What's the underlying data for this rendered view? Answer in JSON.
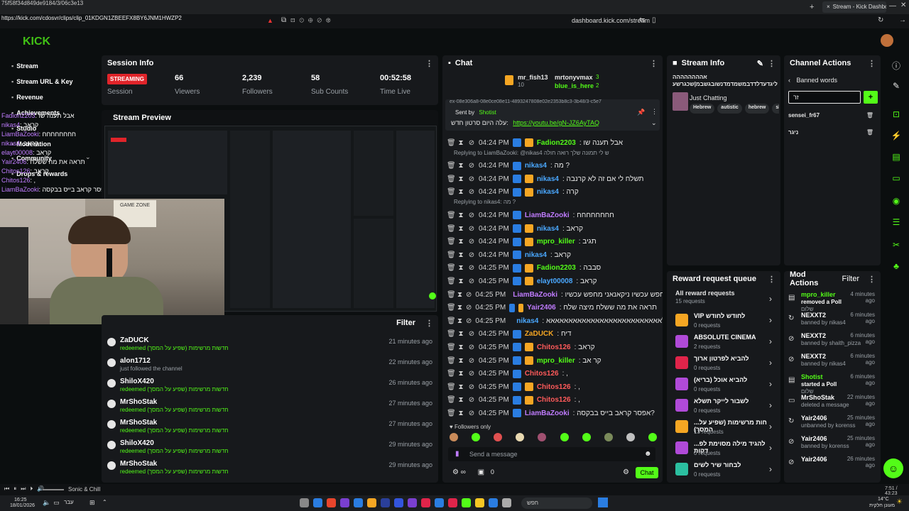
{
  "browser": {
    "tab_label": "Stream - Kick Dashboard",
    "top_left_id": "75f58f34d849de9184/3/06c3e13",
    "url_overlay": "https://kick.com/cdosvr/clips/clip_01KDGN1ZBEEFX8BY6JNM1HWZP2",
    "address": "dashboard.kick.com/stream"
  },
  "left_nav": {
    "items": [
      "Stream",
      "Stream URL & Key",
      "Revenue",
      "Achievements",
      "Studio",
      "Moderation",
      "Community",
      "Drops & rewards"
    ]
  },
  "overlay_chat": [
    {
      "user": "Fadion2203",
      "msg": ": אבל תענה שו"
    },
    {
      "user": "nikas4",
      "msg": ": קראב"
    },
    {
      "user": "LiamBaZooki",
      "msg": ": חחחחחחחח"
    },
    {
      "user": "nikas4",
      "msg": ": קראב"
    },
    {
      "user": "elayt00008",
      "msg": ": קראב"
    },
    {
      "user": "Yair2406",
      "msg": ": תראה את מה ששלח"
    },
    {
      "user": "Chitos126",
      "msg": ": קראב"
    },
    {
      "user": "Chitos126",
      "msg": ": ,"
    },
    {
      "user": "LiamBaZooki",
      "msg": ": אפסר קראב בייס בבקסה?"
    }
  ],
  "session": {
    "title": "Session Info",
    "status": "STREAMING",
    "status_label": "Session",
    "viewers": "66",
    "viewers_label": "Viewers",
    "followers": "2,239",
    "followers_label": "Followers",
    "subs": "58",
    "subs_label": "Sub Counts",
    "time": "00:52:58",
    "time_label": "Time Live"
  },
  "preview": {
    "title": "Stream Preview",
    "webcam_poster": "GAME ZONE"
  },
  "activity": {
    "filter_label": "Filter",
    "items": [
      {
        "name": "ZaDUCK",
        "desc": "redeemed חדשות מרשימות (שפיע על המסך)",
        "time": "21 minutes ago"
      },
      {
        "name": "alon1712",
        "desc": "just followed the channel",
        "time": "22 minutes ago"
      },
      {
        "name": "ShiloX420",
        "desc": "redeemed חדשות מרשימות (שפיע על המסך)",
        "time": "26 minutes ago"
      },
      {
        "name": "MrShoStak",
        "desc": "redeemed חדשות מרשימות (שפיע על המסך)",
        "time": "27 minutes ago"
      },
      {
        "name": "MrShoStak",
        "desc": "redeemed חדשות מרשימות (שפיע על המסך)",
        "time": "27 minutes ago"
      },
      {
        "name": "ShiloX420",
        "desc": "redeemed חדשות מרשימות (שפיע על המסך)",
        "time": "29 minutes ago"
      },
      {
        "name": "MrShoStak",
        "desc": "redeemed חדשות מרשימות (שפיע על המסך)",
        "time": "29 minutes ago"
      }
    ]
  },
  "chat": {
    "title": "Chat",
    "top_gifters": [
      {
        "name": "mr_fish13",
        "count": "10"
      },
      {
        "name": "mrtonyvmax",
        "count": "3"
      },
      {
        "name": "blue_is_here",
        "count": "2"
      }
    ],
    "pinned": {
      "garbled": "ex-08e306a8-08e0ce08e11-4893247808e02e2353b8c3-3b48/3-c5e7",
      "sent_by": "Sent by",
      "sender": "Shotist",
      "text": "עלה היום סרטון חדש:",
      "link": "https://youtu.be/gN-JZ6AyTAQ"
    },
    "messages": [
      {
        "time": "04:24 PM",
        "user": "Fadion2203",
        "msg": ": אבל תענה שו",
        "color": "#53fc18",
        "reply": ""
      },
      {
        "time": "04:24 PM",
        "user": "nikas4",
        "msg": ": מה ?",
        "color": "#4aa8ff",
        "reply": "Replying to LiamBaZooki: @nikas4 ש לי תמונה שלך רואה חולה"
      },
      {
        "time": "04:24 PM",
        "user": "nikas4",
        "msg": ": תשלח לי אם זה לא קרנבה",
        "color": "#4aa8ff",
        "reply": ""
      },
      {
        "time": "04:24 PM",
        "user": "nikas4",
        "msg": ": קרה",
        "color": "#4aa8ff",
        "reply": ""
      },
      {
        "time": "04:24 PM",
        "user": "LiamBaZooki",
        "msg": ": חחחחחחחח",
        "color": "#c07cff",
        "reply": "Replying to nikas4: מה ?"
      },
      {
        "time": "04:24 PM",
        "user": "nikas4",
        "msg": ": קראב",
        "color": "#4aa8ff",
        "reply": ""
      },
      {
        "time": "04:24 PM",
        "user": "mpro_killer",
        "msg": ": תגיב",
        "color": "#53fc18",
        "reply": ""
      },
      {
        "time": "04:24 PM",
        "user": "nikas4",
        "msg": ": קראב",
        "color": "#4aa8ff",
        "reply": ""
      },
      {
        "time": "04:25 PM",
        "user": "Fadion2203",
        "msg": ": סבבה",
        "color": "#53fc18",
        "reply": ""
      },
      {
        "time": "04:25 PM",
        "user": "elayt00008",
        "msg": ": קראב",
        "color": "#4aa8ff",
        "reply": ""
      },
      {
        "time": "04:25 PM",
        "user": "LiamBaZooki",
        "msg": ": אני מחפש עכשיו ניקאנאני מחפש עכשיו",
        "color": "#c07cff",
        "reply": ""
      },
      {
        "time": "04:25 PM",
        "user": "Yair2406",
        "msg": ": תראה את מה ששלח מיצה שלח",
        "color": "#c07cff",
        "reply": ""
      },
      {
        "time": "04:25 PM",
        "user": "nikas4",
        "msg": ": לאאאאאאאאאאאאאאאאאאאאאאאאאא",
        "color": "#4aa8ff",
        "reply": ""
      },
      {
        "time": "04:25 PM",
        "user": "ZaDUCK",
        "msg": ": דיח",
        "color": "#f5a623",
        "reply": ""
      },
      {
        "time": "04:25 PM",
        "user": "Chitos126",
        "msg": ": קראב",
        "color": "#ff5a5a",
        "reply": ""
      },
      {
        "time": "04:25 PM",
        "user": "mpro_killer",
        "msg": ": קר אב",
        "color": "#53fc18",
        "reply": ""
      },
      {
        "time": "04:25 PM",
        "user": "Chitos126",
        "msg": ": ,",
        "color": "#ff5a5a",
        "reply": ""
      },
      {
        "time": "04:25 PM",
        "user": "Chitos126",
        "msg": ": ,",
        "color": "#ff5a5a",
        "reply": ""
      },
      {
        "time": "04:25 PM",
        "user": "Chitos126",
        "msg": ": ,",
        "color": "#ff5a5a",
        "reply": ""
      },
      {
        "time": "04:25 PM",
        "user": "LiamBaZooki",
        "msg": ": אפסר קראב בייס בבקסה?",
        "color": "#c07cff",
        "reply": ""
      }
    ],
    "followers_only": "Followers only",
    "placeholder": "Send a message",
    "count": "0",
    "send_label": "Chat"
  },
  "stream_info": {
    "title": "Stream Info",
    "stream_title": "אהההההההה שקרלעצמשדליגדעדלדדבמשמדמדנשובגשבמ|שכגרשע",
    "category": "Just Chatting",
    "tags": [
      "Hebrew",
      "autistic",
      "hebrew",
      "sh"
    ]
  },
  "channel_actions": {
    "title": "Channel Actions",
    "subtitle": "Banned words",
    "input_value": "זר",
    "words": [
      "sensei_fr67",
      "ניגר"
    ]
  },
  "rewards": {
    "title": "Reward request queue",
    "all_label": "All reward requests",
    "all_count": "15 requests",
    "items": [
      {
        "title": "VIP לחודש לחודש",
        "count": "0 requests",
        "color": "#f5a623"
      },
      {
        "title": "ABSOLUTE CINEMA",
        "count": "2 requests",
        "color": "#b04ad8"
      },
      {
        "title": "להביא לפרטון ארוך",
        "count": "0 requests",
        "color": "#e0244a"
      },
      {
        "title": "להביא אוכל (בריא)",
        "count": "0 requests",
        "color": "#b04ad8"
      },
      {
        "title": "לשבור לייקר תשלא",
        "count": "0 requests",
        "color": "#b04ad8"
      },
      {
        "title": "...חות מרשימות (שפיע על המסך)",
        "count": "13 requests",
        "color": "#f5a623"
      },
      {
        "title": "...להגיד מילה מסוימת לפ דקות",
        "count": "0 requests",
        "color": "#b04ad8"
      },
      {
        "title": "לבחור שיר לשים",
        "count": "0 requests",
        "color": "#2bbfa0"
      }
    ]
  },
  "mod_actions": {
    "title": "Mod Actions",
    "filter": "Filter",
    "items": [
      {
        "name": "mpro_killer",
        "line2": "removed a Poll",
        "line3": "שלום",
        "time": "4 minutes ago",
        "green": true
      },
      {
        "name": "NEXXT2",
        "line2": "banned by nikas4",
        "line3": "",
        "time": "6 minutes ago",
        "green": false
      },
      {
        "name": "NEXXT2",
        "line2": "banned by shaith_pizza",
        "line3": "",
        "time": "6 minutes ago",
        "green": false
      },
      {
        "name": "NEXXT2",
        "line2": "banned by nikas4",
        "line3": "",
        "time": "6 minutes ago",
        "green": false
      },
      {
        "name": "Shotist",
        "line2": "started a Poll",
        "line3": "שלום",
        "time": "6 minutes ago",
        "green": true
      },
      {
        "name": "MrShoStak",
        "line2": "deleted a message",
        "line3": "",
        "time": "22 minutes ago",
        "green": false
      },
      {
        "name": "Yair2406",
        "line2": "unbanned by korenss",
        "line3": "",
        "time": "25 minutes ago",
        "green": false
      },
      {
        "name": "Yair2406",
        "line2": "banned by korenss",
        "line3": "",
        "time": "25 minutes ago",
        "green": false
      },
      {
        "name": "Yair2406",
        "line2": "",
        "line3": "",
        "time": "26 minutes ago",
        "green": false
      }
    ]
  },
  "media_bar": {
    "track": "Sonic & Chill",
    "pos": "7:51 / 43:23"
  },
  "taskbar": {
    "time": "16:25",
    "date": "18/01/2026",
    "lang": "עבר",
    "search": "חפש",
    "weather": "14°C",
    "weather_desc": "מעונן חלקית"
  },
  "colors": {
    "accent": "#53fc18",
    "panel": "#17191c",
    "bg": "#0b0e0f"
  }
}
